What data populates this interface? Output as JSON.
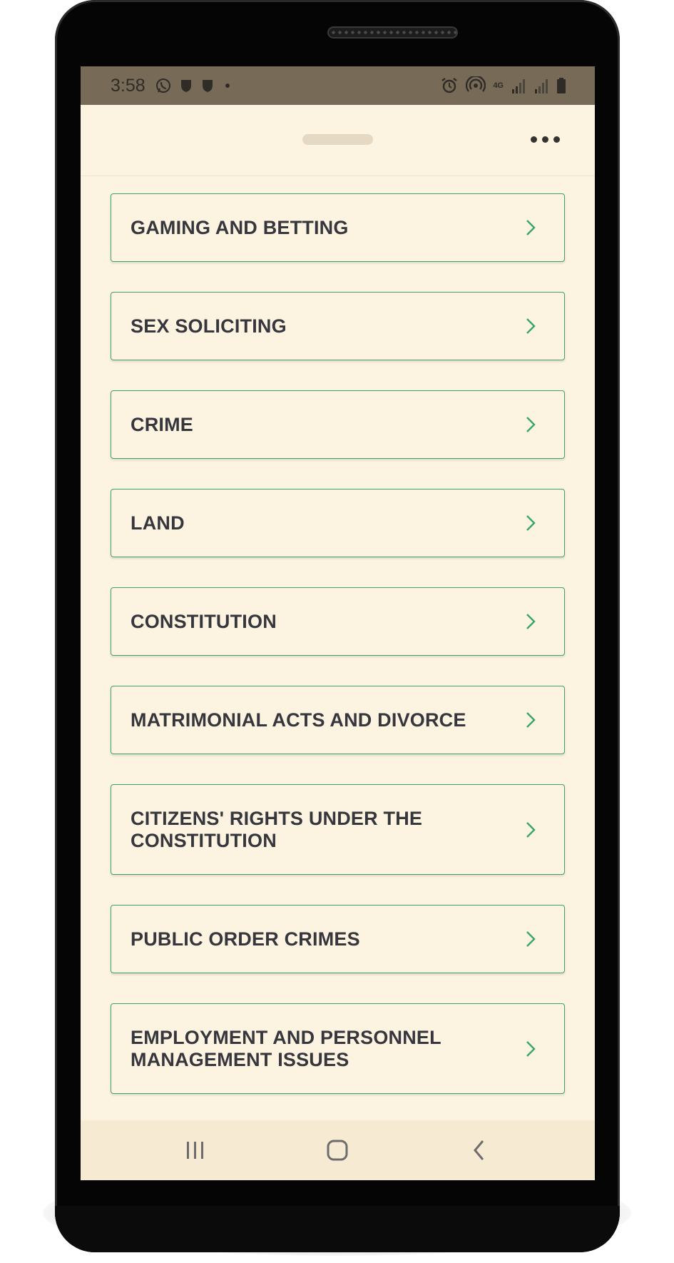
{
  "status_bar": {
    "time": "3:58",
    "left_icons": [
      "whatsapp-icon",
      "shield-icon",
      "shield-icon",
      "dot-icon"
    ],
    "right_icons": [
      "alarm-icon",
      "hotspot-icon",
      "4g-icon",
      "signal-icon",
      "signal-icon",
      "battery-icon"
    ],
    "network_label": "4G"
  },
  "header": {
    "menu_icon": "more-horizontal-icon"
  },
  "categories": [
    {
      "label": "GAMING AND BETTING"
    },
    {
      "label": "SEX SOLICITING"
    },
    {
      "label": "CRIME"
    },
    {
      "label": "LAND"
    },
    {
      "label": "CONSTITUTION"
    },
    {
      "label": "MATRIMONIAL ACTS AND DIVORCE"
    },
    {
      "label": "CITIZENS' RIGHTS UNDER THE CONSTITUTION"
    },
    {
      "label": "PUBLIC ORDER CRIMES"
    },
    {
      "label": "EMPLOYMENT AND PERSONNEL MANAGEMENT ISSUES"
    }
  ],
  "nav_bar": {
    "buttons": [
      "recents-icon",
      "home-icon",
      "back-icon"
    ]
  },
  "colors": {
    "accent": "#3aa56a",
    "background": "#fdf3e1",
    "status_bar": "#776b57",
    "text": "#36363d"
  }
}
